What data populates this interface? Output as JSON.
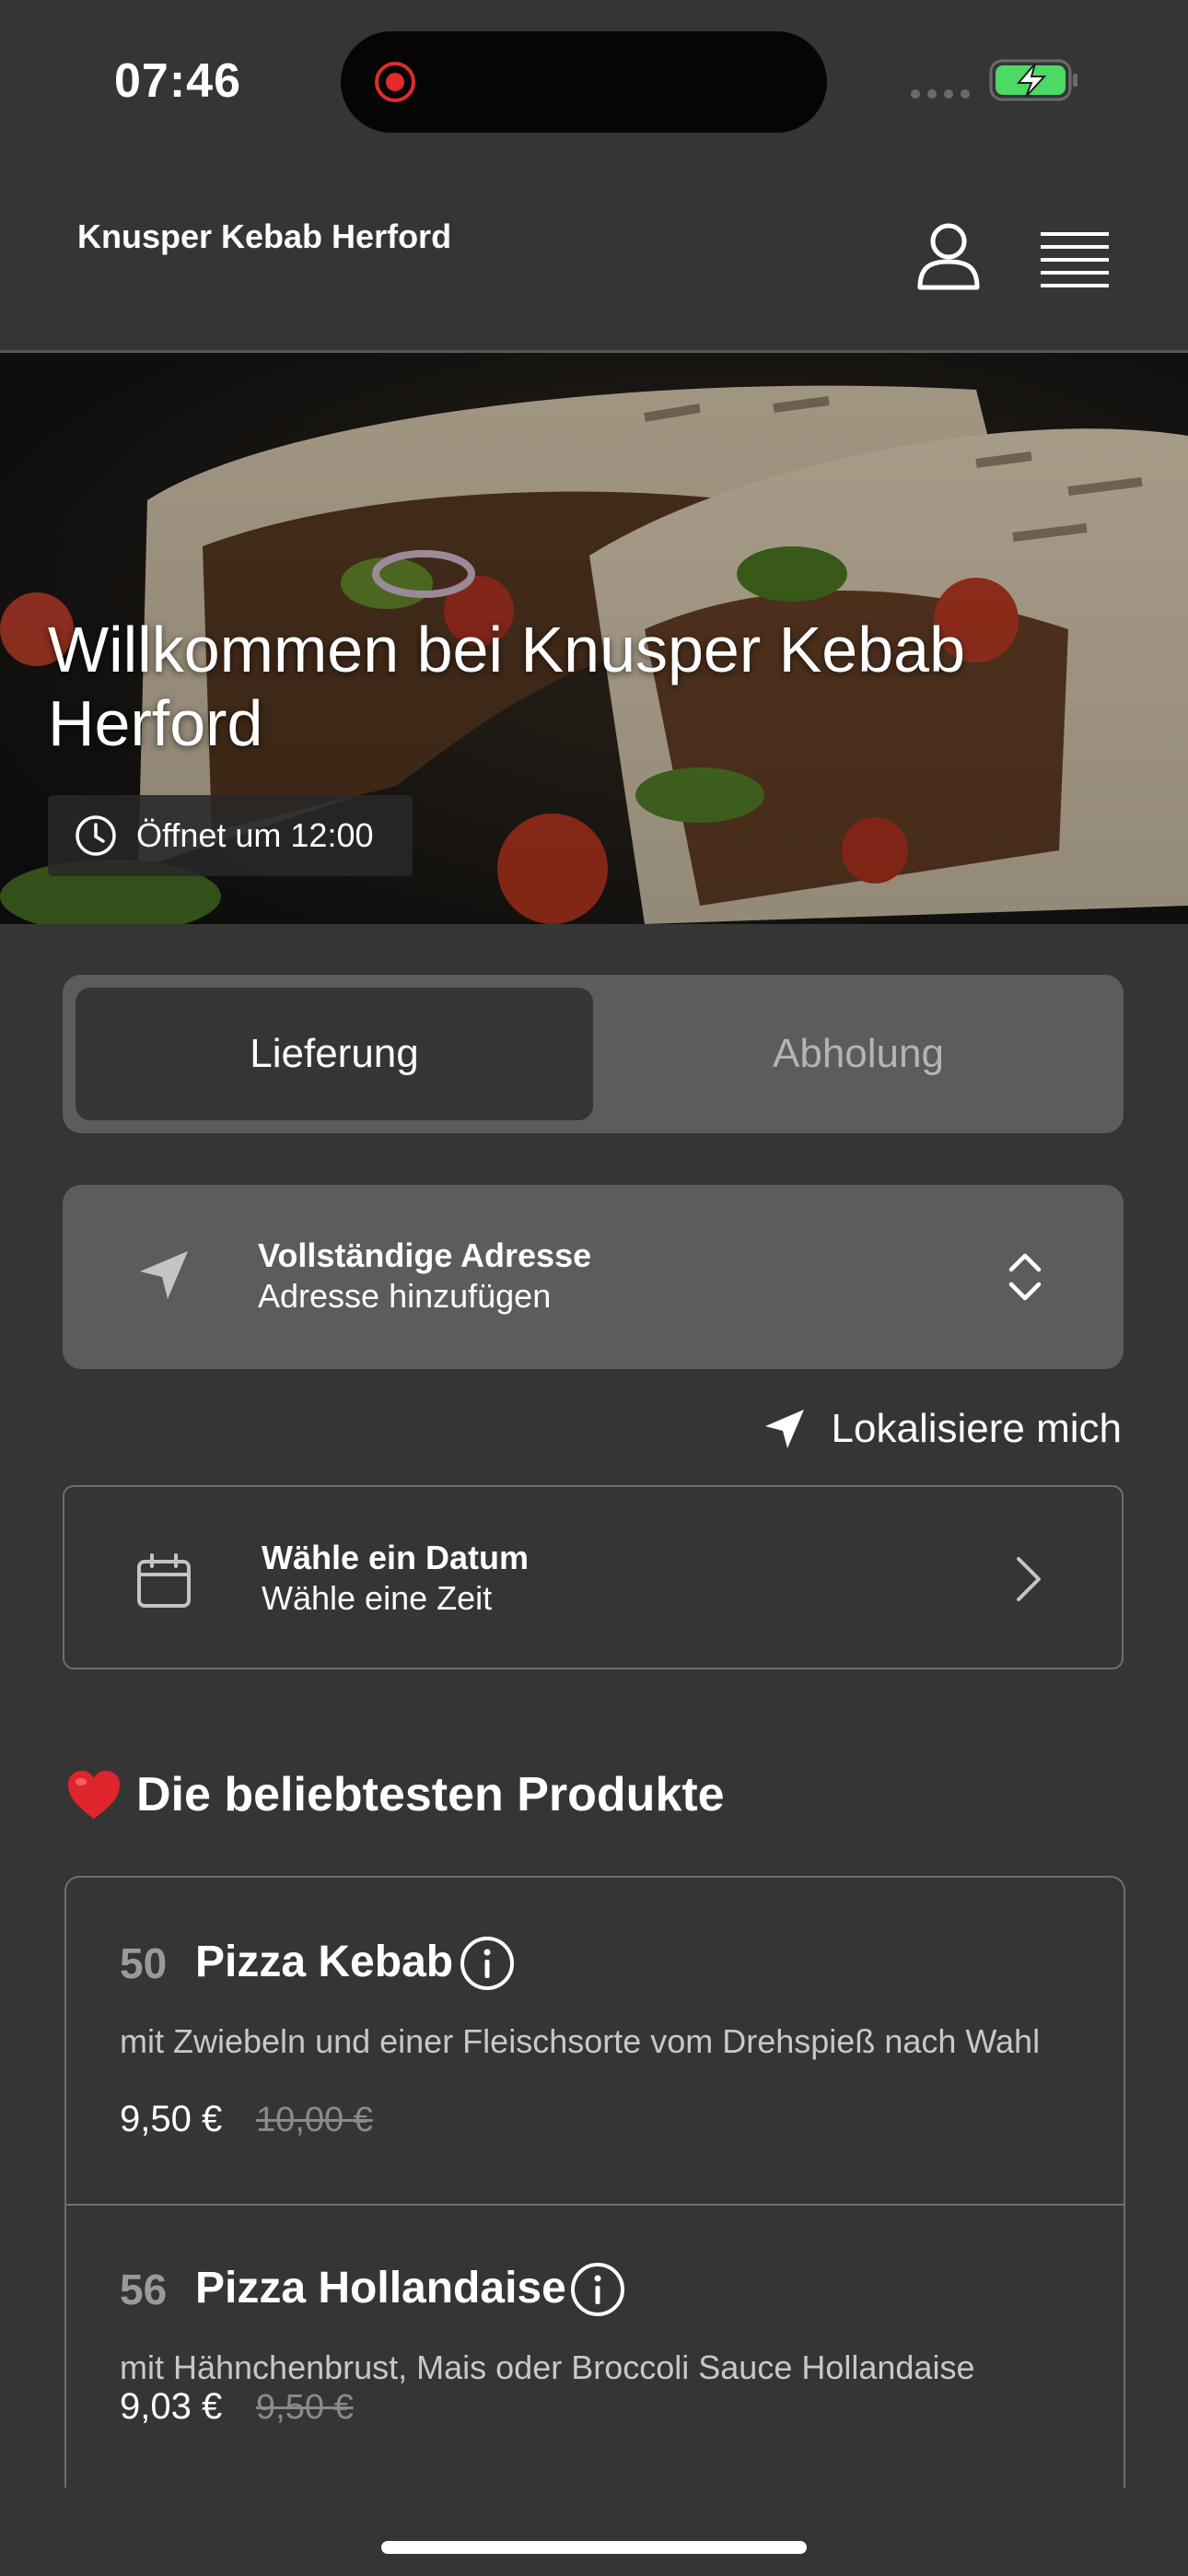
{
  "status_bar": {
    "time": "07:46"
  },
  "header": {
    "brand": "Knusper Kebab Herford"
  },
  "hero": {
    "title": "Willkommen bei Knusper Kebab Herford",
    "opening": "Öffnet um 12:00"
  },
  "order_mode": {
    "delivery": "Lieferung",
    "pickup": "Abholung",
    "selected": "Lieferung"
  },
  "address": {
    "title": "Vollständige Adresse",
    "subtitle": "Adresse hinzufügen"
  },
  "locate": {
    "label": "Lokalisiere mich"
  },
  "date_picker": {
    "title": "Wähle ein Datum",
    "subtitle": "Wähle eine Zeit"
  },
  "popular": {
    "title": "Die beliebtesten Produkte",
    "products": [
      {
        "number": "50",
        "name": "Pizza Kebab",
        "description": "mit Zwiebeln und einer Fleischsorte vom Drehspieß nach Wahl",
        "price": "9,50 €",
        "old_price": "10,00 €"
      },
      {
        "number": "56",
        "name": "Pizza Hollandaise",
        "description": "mit Hähnchenbrust, Mais oder Broccoli Sauce Hollandaise",
        "price": "9,03 €",
        "old_price": "9,50 €"
      }
    ]
  },
  "colors": {
    "background": "#353535",
    "card": "#5c5c5c",
    "battery_green": "#4cd964",
    "heart": "#e0242c"
  }
}
